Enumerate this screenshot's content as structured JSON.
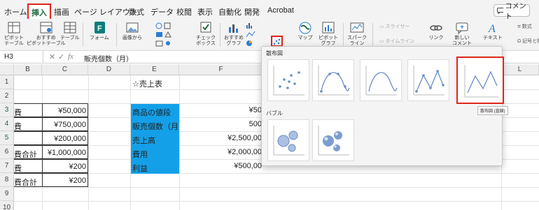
{
  "tabs": [
    "ホーム",
    "挿入",
    "描画",
    "ページ レイアウト",
    "数式",
    "データ",
    "校閲",
    "表示",
    "自動化",
    "開発",
    "Acrobat"
  ],
  "active_tab": "挿入",
  "comment_button": "コメント",
  "ribbon": {
    "pivot_table": "ピボット\nテーブル",
    "recommended_pivot": "おすすめ\nピボットテーブル",
    "table": "テーブル",
    "forms": "フォーム",
    "image": "画像から",
    "checkbox": "チェック\nボックス",
    "recommended_charts": "おすすめ\nグラフ",
    "maps": "マップ",
    "pivot_chart": "ピボット\nグラフ",
    "sparklines": "スパーク\nライン",
    "slicer": "スライサー",
    "timeline": "タイムライン",
    "link": "リンク",
    "new_comment": "新しい\nコメント",
    "text": "テキスト",
    "equation": "π 数式",
    "symbol": "Ω 記号と特殊文字"
  },
  "formula_bar": {
    "name_box": "H3",
    "cancel_symbol": "✕",
    "confirm_symbol": "✓",
    "fx": "fx",
    "value": "販売個数（月）"
  },
  "columns": [
    "B",
    "C",
    "D",
    "E",
    "F",
    "L"
  ],
  "rows": [
    "1",
    "2",
    "3",
    "4",
    "5",
    "6",
    "7",
    "8",
    "9",
    "10"
  ],
  "cells": {
    "e1": "☆売上表",
    "b3": "費",
    "c3": "¥50,000",
    "b4": "費",
    "c4": "¥750,000",
    "c5": "¥200,000",
    "b6": "費合計",
    "c6": "¥1,000,000",
    "b7": "費",
    "c7": "¥200",
    "b8": "費合計",
    "c8": "¥200",
    "e3": "商品の値段",
    "f3": "¥50",
    "e4": "販売個数（月）",
    "f4": "500",
    "e5": "売上高",
    "f5": "¥2,500,00",
    "e6": "費用",
    "f6": "¥2,000,00",
    "e7": "利益",
    "f7": "¥500,00"
  },
  "popup": {
    "scatter_section": "散布図",
    "bubble_section": "バブル",
    "tooltip": "散布図 (直線)"
  },
  "colors": {
    "accent_red": "#e0251b",
    "cell_blue": "#14a0e8",
    "excel_green": "#1d6b3f"
  }
}
